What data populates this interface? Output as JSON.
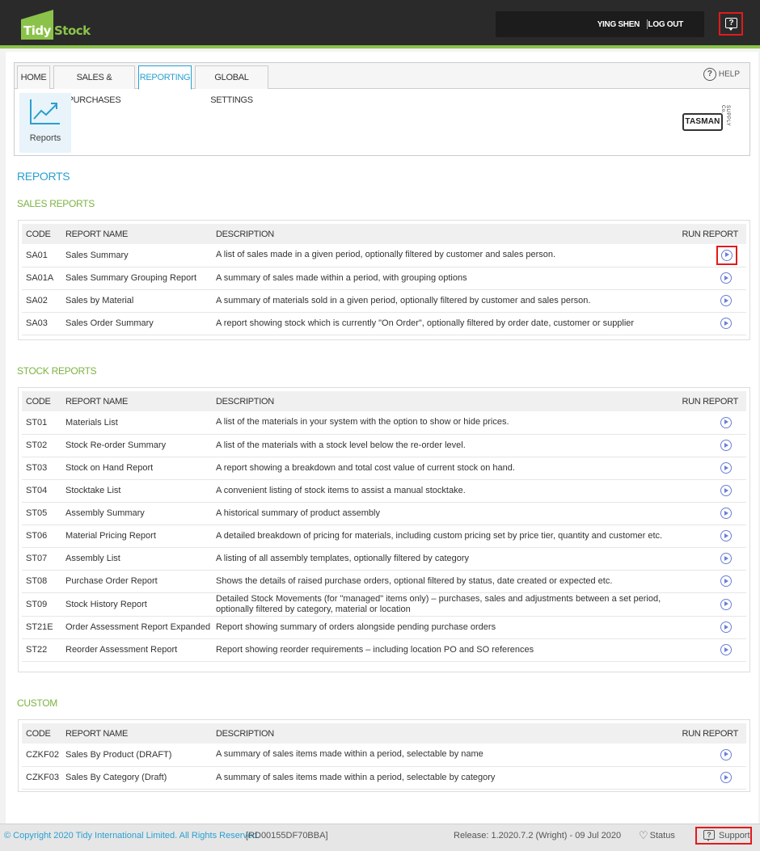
{
  "header": {
    "logo_part1": "Tidy",
    "logo_part2": "Stock",
    "user_name": "YING SHEN",
    "logout_label": "LOG OUT",
    "help_glyph": "?"
  },
  "tabs": [
    {
      "label": "HOME"
    },
    {
      "label": "SALES & PURCHASES"
    },
    {
      "label": "REPORTING"
    },
    {
      "label": "GLOBAL SETTINGS"
    }
  ],
  "help_label": "HELP",
  "help_glyph": "?",
  "reports_tile_label": "Reports",
  "brand_logo": {
    "name": "TASMAN",
    "sub": "SUPPLY Co."
  },
  "page_title": "REPORTS",
  "columns": {
    "code": "CODE",
    "name": "REPORT NAME",
    "description": "DESCRIPTION",
    "run": "RUN REPORT"
  },
  "sections": [
    {
      "title": "SALES REPORTS",
      "rows": [
        {
          "code": "SA01",
          "name": "Sales Summary",
          "description": "A list of sales made in a given period, optionally filtered by customer and sales person."
        },
        {
          "code": "SA01A",
          "name": "Sales Summary Grouping Report",
          "description": "A summary of sales made within a period, with grouping options"
        },
        {
          "code": "SA02",
          "name": "Sales by Material",
          "description": "A summary of materials sold in a given period, optionally filtered by customer and sales person."
        },
        {
          "code": "SA03",
          "name": "Sales Order Summary",
          "description": "A report showing stock which is currently \"On Order\", optionally filtered by order date, customer or supplier"
        }
      ]
    },
    {
      "title": "STOCK REPORTS",
      "rows": [
        {
          "code": "ST01",
          "name": "Materials List",
          "description": "A list of the materials in your system with the option to show or hide prices."
        },
        {
          "code": "ST02",
          "name": "Stock Re-order Summary",
          "description": "A list of the materials with a stock level below the re-order level."
        },
        {
          "code": "ST03",
          "name": "Stock on Hand Report",
          "description": "A report showing a breakdown and total cost value of current stock on hand."
        },
        {
          "code": "ST04",
          "name": "Stocktake List",
          "description": "A convenient listing of stock items to assist a manual stocktake."
        },
        {
          "code": "ST05",
          "name": "Assembly Summary",
          "description": "A historical summary of product assembly"
        },
        {
          "code": "ST06",
          "name": "Material Pricing Report",
          "description": "A detailed breakdown of pricing for materials, including custom pricing set by price tier, quantity and customer etc."
        },
        {
          "code": "ST07",
          "name": "Assembly List",
          "description": "A listing of all assembly templates, optionally filtered by category"
        },
        {
          "code": "ST08",
          "name": "Purchase Order Report",
          "description": "Shows the details of raised purchase orders, optional filtered by status, date created or expected etc."
        },
        {
          "code": "ST09",
          "name": "Stock History Report",
          "description": "Detailed Stock Movements (for \"managed\" items only) – purchases, sales and adjustments between a set period, optionally filtered by category, material or location"
        },
        {
          "code": "ST21E",
          "name": "Order Assessment Report Expanded",
          "description": "Report showing summary of orders alongside pending purchase orders"
        },
        {
          "code": "ST22",
          "name": "Reorder Assessment Report",
          "description": "Report showing reorder requirements – including location PO and SO references"
        }
      ]
    },
    {
      "title": "CUSTOM",
      "rows": [
        {
          "code": "CZKF02",
          "name": "Sales By Product (DRAFT)",
          "description": "A summary of sales items made within a period, selectable by name"
        },
        {
          "code": "CZKF03",
          "name": "Sales By Category (Draft)",
          "description": "A summary of sales items made within a period, selectable by category"
        }
      ]
    }
  ],
  "footer": {
    "copyright": "© Copyright 2020 Tidy International Limited. All Rights Reserved.",
    "build": "[RD00155DF70BBA]",
    "release": "Release: 1.2020.7.2 (Wright) - 09 Jul 2020",
    "status_label": "Status",
    "support_label": "Support",
    "support_glyph": "?"
  },
  "icons": {
    "help": "help-question-icon",
    "reports": "trend-chart-icon",
    "run": "play-circle-icon",
    "status": "heartbeat-icon",
    "support": "support-bubble-icon"
  },
  "colors": {
    "brand_green": "#8bc34a",
    "accent_blue": "#29a0d0",
    "section_green": "#7cb342",
    "run_icon": "#6b7fd7",
    "highlight_red": "#e21b1b"
  }
}
